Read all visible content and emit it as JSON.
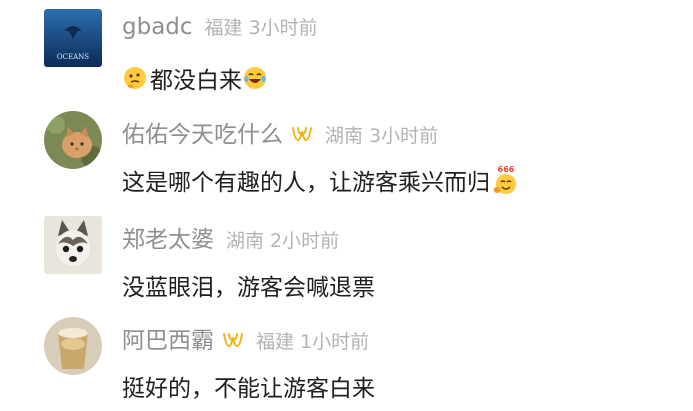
{
  "comments": [
    {
      "username": "gbadc",
      "location": "福建",
      "time": "3小时前",
      "text_parts": [
        "都没白来"
      ],
      "avatar_caption": "OCEANS"
    },
    {
      "username": "佑佑今天吃什么",
      "location": "湖南",
      "time": "3小时前",
      "text_parts": [
        "这是哪个有趣的人，让游客乘兴而归"
      ],
      "emoji_caption": "666"
    },
    {
      "username": "郑老太婆",
      "location": "湖南",
      "time": "2小时前",
      "text_parts": [
        "没蓝眼泪，游客会喊退票"
      ]
    },
    {
      "username": "阿巴西霸",
      "location": "福建",
      "time": "1小时前",
      "text_parts": [
        "挺好的，不能让游客白来"
      ]
    }
  ],
  "icons": {
    "badge": "vip-badge-icon",
    "emoji_thinking": "thinking-face-icon",
    "emoji_laugh": "laughing-tears-icon",
    "emoji_666": "666-emoji-icon"
  },
  "colors": {
    "username": "#8f8f8f",
    "meta": "#b3b3b3",
    "text": "#1f1f1f",
    "badge": "#f2b31a"
  }
}
